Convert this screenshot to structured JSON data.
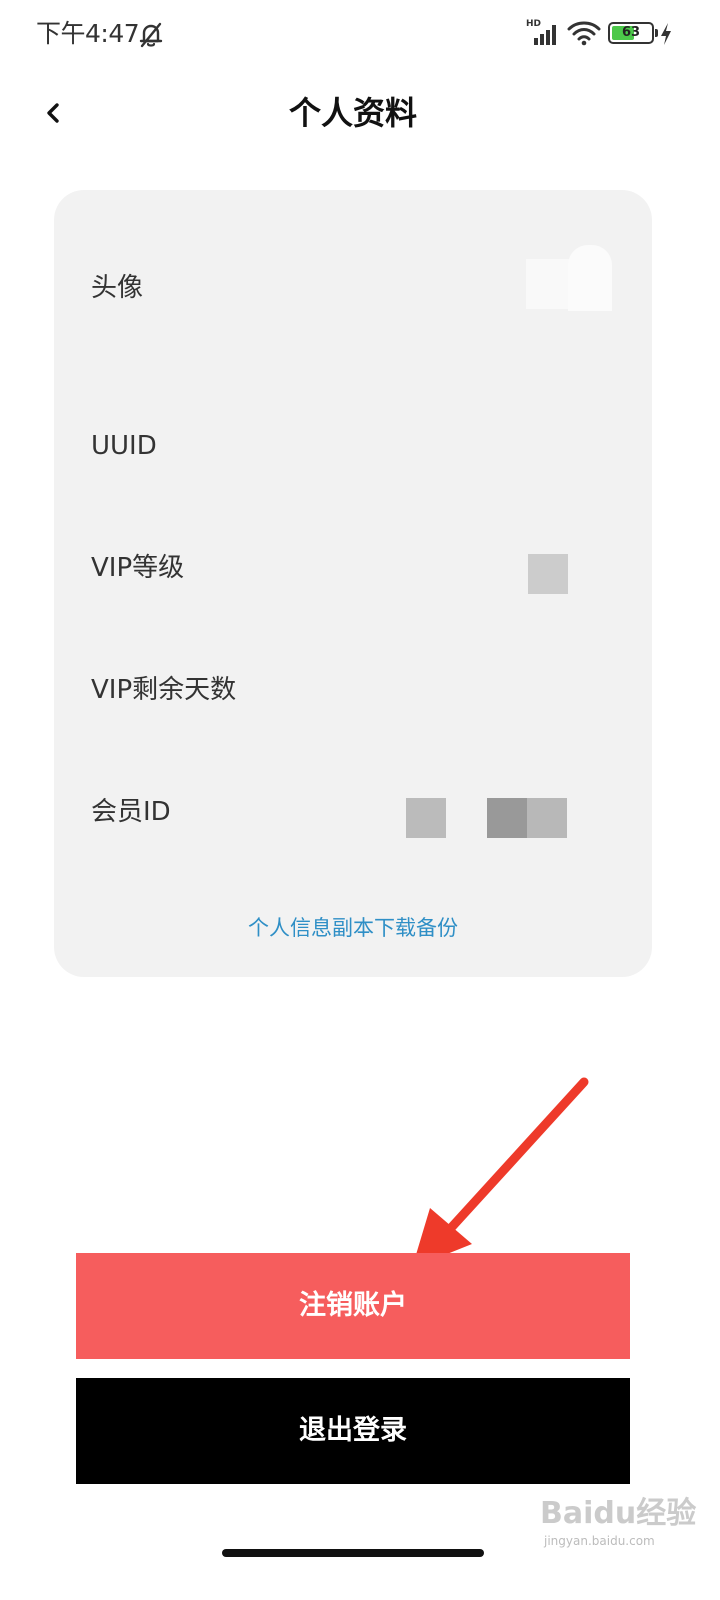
{
  "status_bar": {
    "time": "下午4:47",
    "network_label": "HD",
    "battery_level": 63,
    "battery_text": "63",
    "icons": [
      "bell-off-icon",
      "signal-icon",
      "wifi-icon",
      "battery-icon",
      "charging-icon"
    ],
    "battery_color": "#4cc84a"
  },
  "header": {
    "back_icon": "chevron-left-icon",
    "title": "个人资料"
  },
  "profile": {
    "fields": [
      {
        "label": "头像"
      },
      {
        "label": "UUID"
      },
      {
        "label": "VIP等级"
      },
      {
        "label": "VIP剩余天数"
      },
      {
        "label": "会员ID"
      }
    ],
    "download_link": "个人信息副本下载备份",
    "card_color": "#f2f2f2",
    "link_color": "#2f8fc6"
  },
  "actions": {
    "cancel_account_label": "注销账户",
    "cancel_account_color": "#f65d5d",
    "logout_label": "退出登录",
    "logout_color": "#000000"
  },
  "annotation": {
    "arrow_icon": "red-arrow-icon",
    "arrow_color": "#ee3a2a"
  },
  "watermark": {
    "text": "Baidu经验",
    "subtext": "jingyan.baidu.com"
  }
}
